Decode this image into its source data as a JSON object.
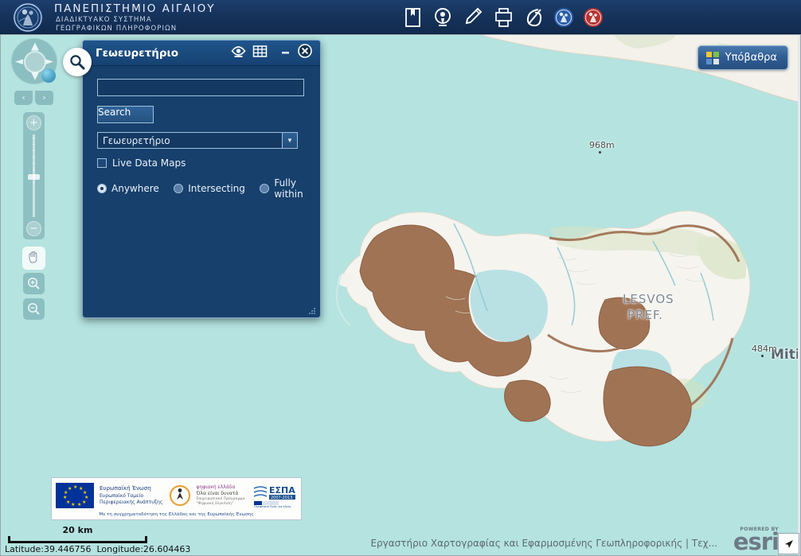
{
  "header": {
    "title_line1": "ΠΑΝΕΠΙΣΤΗΜΙΟ ΑΙΓΑΙΟΥ",
    "title_line2": "ΔΙΑΔΙΚΤΥΑΚΟ ΣΥΣΤΗΜΑ",
    "title_line3": "ΓΕΩΓΡΑΦΙΚΩΝ ΠΛΗΡΟΦΟΡΙΩΝ",
    "logo_icon": "university-seal-icon",
    "tools": [
      {
        "icon": "bookmark-icon",
        "name": "bookmark-tool"
      },
      {
        "icon": "identify-search-icon",
        "name": "identify-tool"
      },
      {
        "icon": "pencil-draw-icon",
        "name": "draw-tool"
      },
      {
        "icon": "print-icon",
        "name": "print-tool"
      },
      {
        "icon": "measure-icon",
        "name": "measure-tool"
      },
      {
        "icon": "blue-seal-icon",
        "name": "blue-seal-link"
      },
      {
        "icon": "red-seal-icon",
        "name": "red-seal-link"
      }
    ],
    "bg_color": "#16335b"
  },
  "basemap_button": {
    "label": "Υπόβαθρα",
    "icon": "grid-squares-icon",
    "swatch_colors": [
      "#f2c637",
      "#7fc241",
      "#5a90d0",
      "#e0e4ea"
    ]
  },
  "dialog": {
    "title": "Γεωευρετήριο",
    "handle_icon": "search-magnifier-icon",
    "title_icons": [
      {
        "icon": "eye-visibility-icon",
        "name": "toggle-results-visibility"
      },
      {
        "icon": "table-grid-icon",
        "name": "show-results-table"
      },
      {
        "icon": "minimize-icon",
        "name": "minimize-dialog"
      },
      {
        "icon": "close-icon",
        "name": "close-dialog"
      }
    ],
    "search_input_value": "",
    "search_input_placeholder": "",
    "search_button_label": "Search",
    "layer_select_value": "Γεωευρετήριο",
    "layer_select_options": [
      "Γεωευρετήριο"
    ],
    "live_data_checkbox": {
      "label": "Live Data Maps",
      "checked": false
    },
    "spatial_radios": [
      {
        "label": "Anywhere",
        "selected": true
      },
      {
        "label": "Intersecting",
        "selected": false
      },
      {
        "label": "Fully within",
        "selected": false
      }
    ],
    "resize_grip_icon": "resize-grip-icon"
  },
  "nav": {
    "pan_pad_icon": "pan-globe-icon",
    "pan_arrows": [
      "▲",
      "▼",
      "◄",
      "►"
    ],
    "prev_extent_label": "‹",
    "next_extent_label": "›",
    "zoom_in_label": "+",
    "zoom_out_label": "−",
    "mode_buttons": [
      {
        "icon": "pan-hand-icon",
        "name": "pan-mode-button",
        "active": true
      },
      {
        "icon": "zoom-in-magnifier-icon",
        "name": "zoom-in-mode-button",
        "active": false
      },
      {
        "icon": "zoom-out-magnifier-icon",
        "name": "zoom-out-mode-button",
        "active": false
      }
    ]
  },
  "map": {
    "sea_color": "#b4e3e0",
    "land_color": "#f6f4ef",
    "highlight_color": "#a07354",
    "labels": [
      {
        "text": "968m",
        "type": "elevation"
      },
      {
        "text": "484m",
        "type": "elevation"
      },
      {
        "text": "LESVOS",
        "type": "area"
      },
      {
        "text": "PREF.",
        "type": "area"
      },
      {
        "text": "Mitil",
        "type": "city"
      }
    ]
  },
  "footer": {
    "scale_label": "20 km",
    "latitude_label": "Latitude:",
    "latitude_value": "39.446756",
    "longitude_label": "Longitude:",
    "longitude_value": "26.604463",
    "attribution": "Εργαστήριο Χαρτογραφίας και Εφαρμοσμένης Γεωπληροφορικής | Τεχ...",
    "esri_powered_by": "POWERED BY",
    "esri_wordmark": "esri",
    "collapse_icon": "collapse-arrow-icon"
  },
  "funding_banner": {
    "eu_title": "Ευρωπαϊκή Ένωση",
    "eu_sub": "Ευρωπαϊκό Ταμείο Περιφερειακής Ανάπτυξης",
    "digital_title": "ψηφιακή ελλάδα",
    "digital_sub1": "Όλα είναι δυνατά",
    "digital_sub2": "Επιχειρησιακό Πρόγραμμα \"Ψηφιακή Σύγκλιση\"",
    "espa_title": "ΕΣΠΑ",
    "espa_years": "2007-2013",
    "espa_sub": "Περιφέρεια ζωής για όλους",
    "bottom_note": "Με τη συγχρηματοδότηση της Ελλάδας και της Ευρωπαϊκής Ένωσης"
  }
}
